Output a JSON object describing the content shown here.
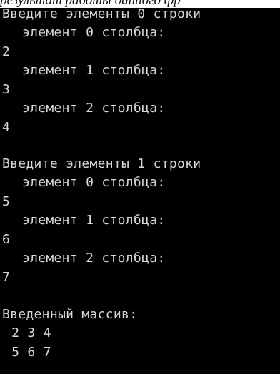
{
  "caption": "результат работы данного фр",
  "console": {
    "lines": [
      "Введите элементы 0 строки",
      "элемент 0 столбца:",
      "2",
      "элемент 1 столбца:",
      "3",
      "элемент 2 столбца:",
      "4",
      "Введите элементы 1 строки",
      "элемент 0 столбца:",
      "5",
      "элемент 1 столбца:",
      "6",
      "элемент 2 столбца:",
      "7",
      "Введенный массив:",
      " 2 3 4",
      " 5 6 7"
    ],
    "text_color": "#d8d8d8",
    "background_color": "#000000"
  }
}
